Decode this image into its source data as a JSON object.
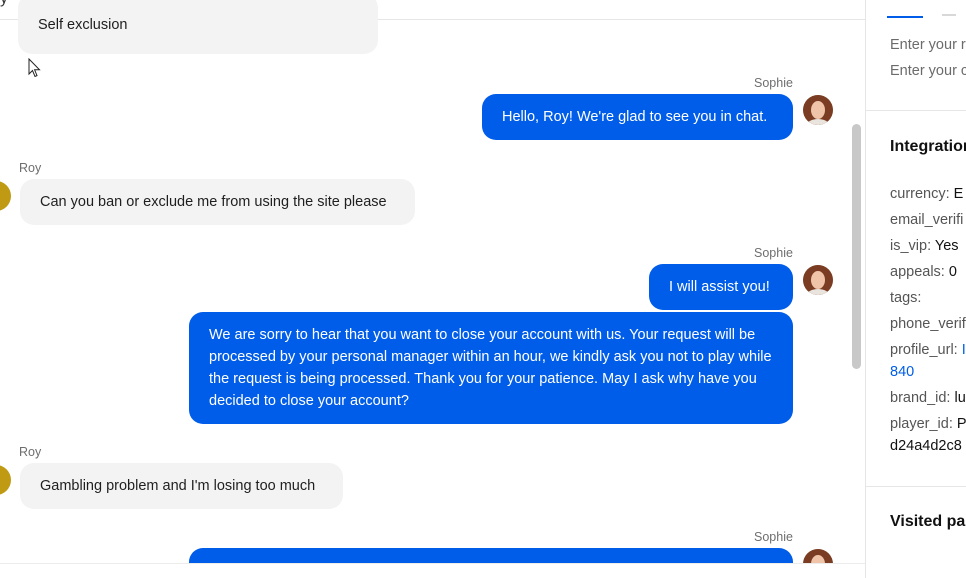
{
  "chat": {
    "messages": [
      {
        "id": "m0",
        "direction": "in",
        "text": "Self exclusion"
      },
      {
        "id": "m1",
        "direction": "out",
        "sender": "Sophie",
        "text": "Hello, Roy! We're glad to see you in chat."
      },
      {
        "id": "m2",
        "direction": "in",
        "sender": "Roy",
        "text": "Can you ban or exclude me from using the site please"
      },
      {
        "id": "m3",
        "direction": "out",
        "sender": "Sophie",
        "text": "I will assist you!"
      },
      {
        "id": "m4",
        "direction": "out",
        "text": "We are sorry to hear that you want to close your account with us. Your request will be processed by your personal manager within an hour, we kindly ask you not to play while the request is being processed. Thank you for your patience. May I ask why have you decided to close your account?"
      },
      {
        "id": "m5",
        "direction": "in",
        "sender": "Roy",
        "text": "Gambling problem and I'm losing too much"
      },
      {
        "id": "m6",
        "direction": "out",
        "sender": "Sophie",
        "text": ""
      }
    ],
    "colors": {
      "outgoing": "#005de9",
      "incoming": "#f3f3f3",
      "user_avatar": "#bf9a12"
    }
  },
  "panel": {
    "fields": {
      "name_placeholder": "Enter your r",
      "second_placeholder": "Enter your c"
    },
    "integration": {
      "title": "Integration",
      "rows": [
        {
          "key": "currency:",
          "value": "E"
        },
        {
          "key": "email_verifi",
          "value": ""
        },
        {
          "key": "is_vip:",
          "value": "Yes"
        },
        {
          "key": "appeals:",
          "value": "0"
        },
        {
          "key": "tags:",
          "value": ""
        },
        {
          "key": "phone_verif",
          "value": ""
        },
        {
          "key": "profile_url:",
          "value": "I",
          "link": true,
          "continuation": "840"
        },
        {
          "key": "brand_id:",
          "value": "lu"
        },
        {
          "key": "player_id:",
          "value": "P",
          "continuation": "d24a4d2c8"
        }
      ]
    },
    "visited": {
      "title": "Visited pa"
    }
  }
}
